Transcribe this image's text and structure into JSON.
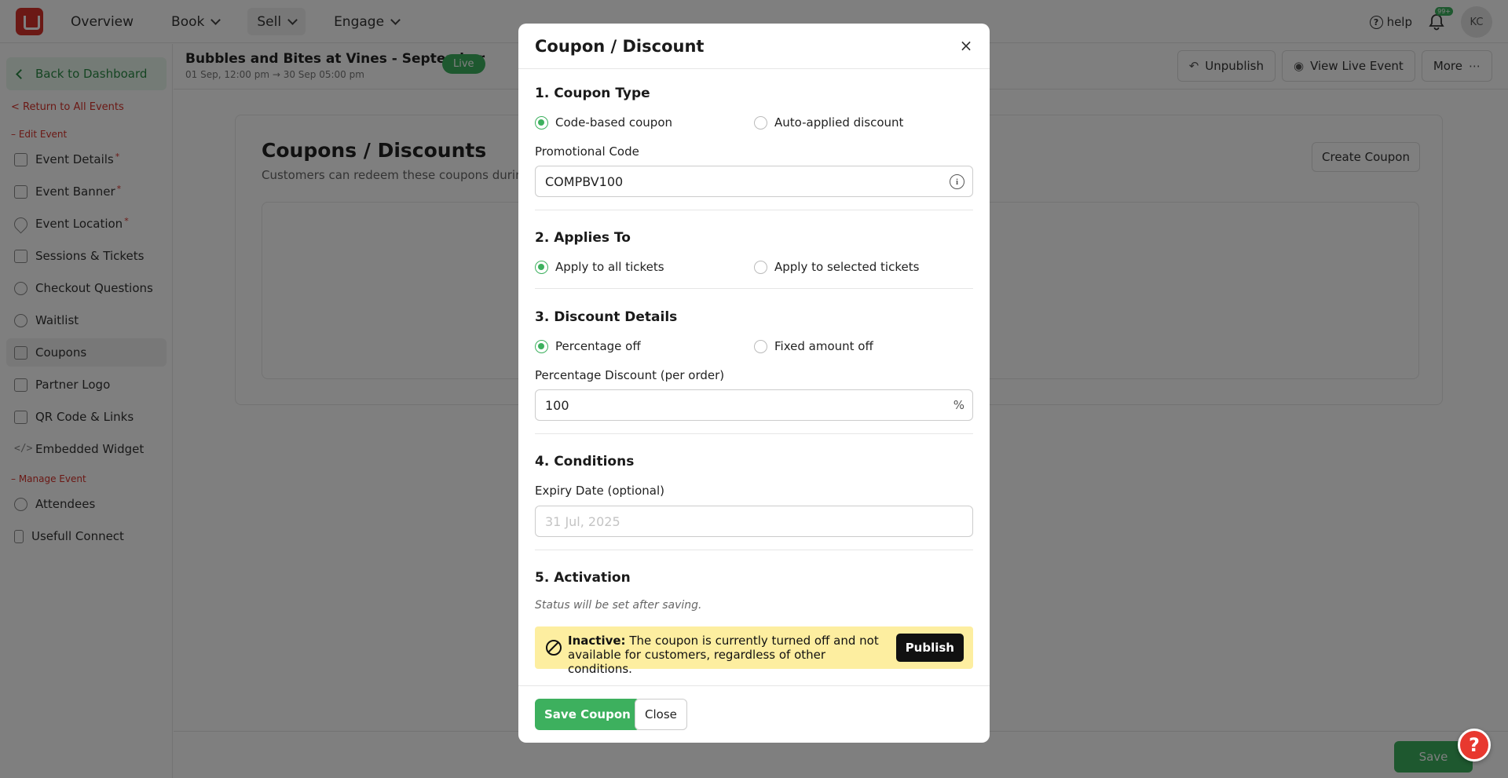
{
  "topnav": {
    "items": [
      {
        "label": "Overview",
        "dropdown": false
      },
      {
        "label": "Book",
        "dropdown": true
      },
      {
        "label": "Sell",
        "dropdown": true
      },
      {
        "label": "Engage",
        "dropdown": true
      }
    ],
    "help_label": "help",
    "notification_count": "99+",
    "avatar_initials": "KC"
  },
  "sidebar": {
    "back_label": "Back to Dashboard",
    "return_label": "< Return to All Events",
    "edit_section": "– Edit Event",
    "manage_section": "– Manage Event",
    "items": [
      {
        "label": "Event Details",
        "required": true
      },
      {
        "label": "Event Banner",
        "required": true
      },
      {
        "label": "Event Location",
        "required": true
      },
      {
        "label": "Sessions & Tickets",
        "required": false
      },
      {
        "label": "Checkout Questions",
        "required": false
      },
      {
        "label": "Waitlist",
        "required": false
      },
      {
        "label": "Coupons",
        "required": false
      },
      {
        "label": "Partner Logo",
        "required": false
      },
      {
        "label": "QR Code & Links",
        "required": false
      },
      {
        "label": "Embedded Widget",
        "required": false
      }
    ],
    "manage_items": [
      {
        "label": "Attendees"
      },
      {
        "label": "Usefull Connect"
      }
    ],
    "required_mark": "*"
  },
  "event": {
    "title": "Bubbles and Bites at Vines - September",
    "dates": "01 Sep, 12:00 pm → 30 Sep 05:00 pm",
    "status": "Live",
    "buttons": {
      "unpublish": "Unpublish",
      "view_live": "View Live Event",
      "more": "More"
    }
  },
  "page": {
    "title": "Coupons / Discounts",
    "subtitle": "Customers can redeem these coupons during",
    "create_button": "Create Coupon",
    "save_button": "Save"
  },
  "modal": {
    "title": "Coupon / Discount",
    "close_icon": "×",
    "sections": {
      "type": {
        "title": "1. Coupon Type",
        "options": [
          "Code-based coupon",
          "Auto-applied discount"
        ],
        "selected": "Code-based coupon",
        "code_label": "Promotional Code",
        "code_value": "COMPBV100"
      },
      "applies": {
        "title": "2. Applies To",
        "options": [
          "Apply to all tickets",
          "Apply to selected tickets"
        ],
        "selected": "Apply to all tickets"
      },
      "discount": {
        "title": "3. Discount Details",
        "options": [
          "Percentage off",
          "Fixed amount off"
        ],
        "selected": "Percentage off",
        "pct_label": "Percentage Discount (per order)",
        "pct_value": "100",
        "pct_suffix": "%"
      },
      "conditions": {
        "title": "4. Conditions",
        "expiry_label": "Expiry Date (optional)",
        "expiry_placeholder": "31 Jul, 2025"
      },
      "activation": {
        "title": "5. Activation",
        "note": "Status will be set after saving.",
        "alert_strong": "Inactive:",
        "alert_text": " The coupon is currently turned off and not available for customers, regardless of other conditions.",
        "publish_label": "Publish"
      }
    },
    "footer": {
      "save_label": "Save Coupon",
      "close_label": "Close"
    }
  },
  "help_fab": "?",
  "colors": {
    "brand_red": "#d6322b",
    "accent_green": "#3db05e",
    "alert_yellow": "#fdeea0"
  }
}
